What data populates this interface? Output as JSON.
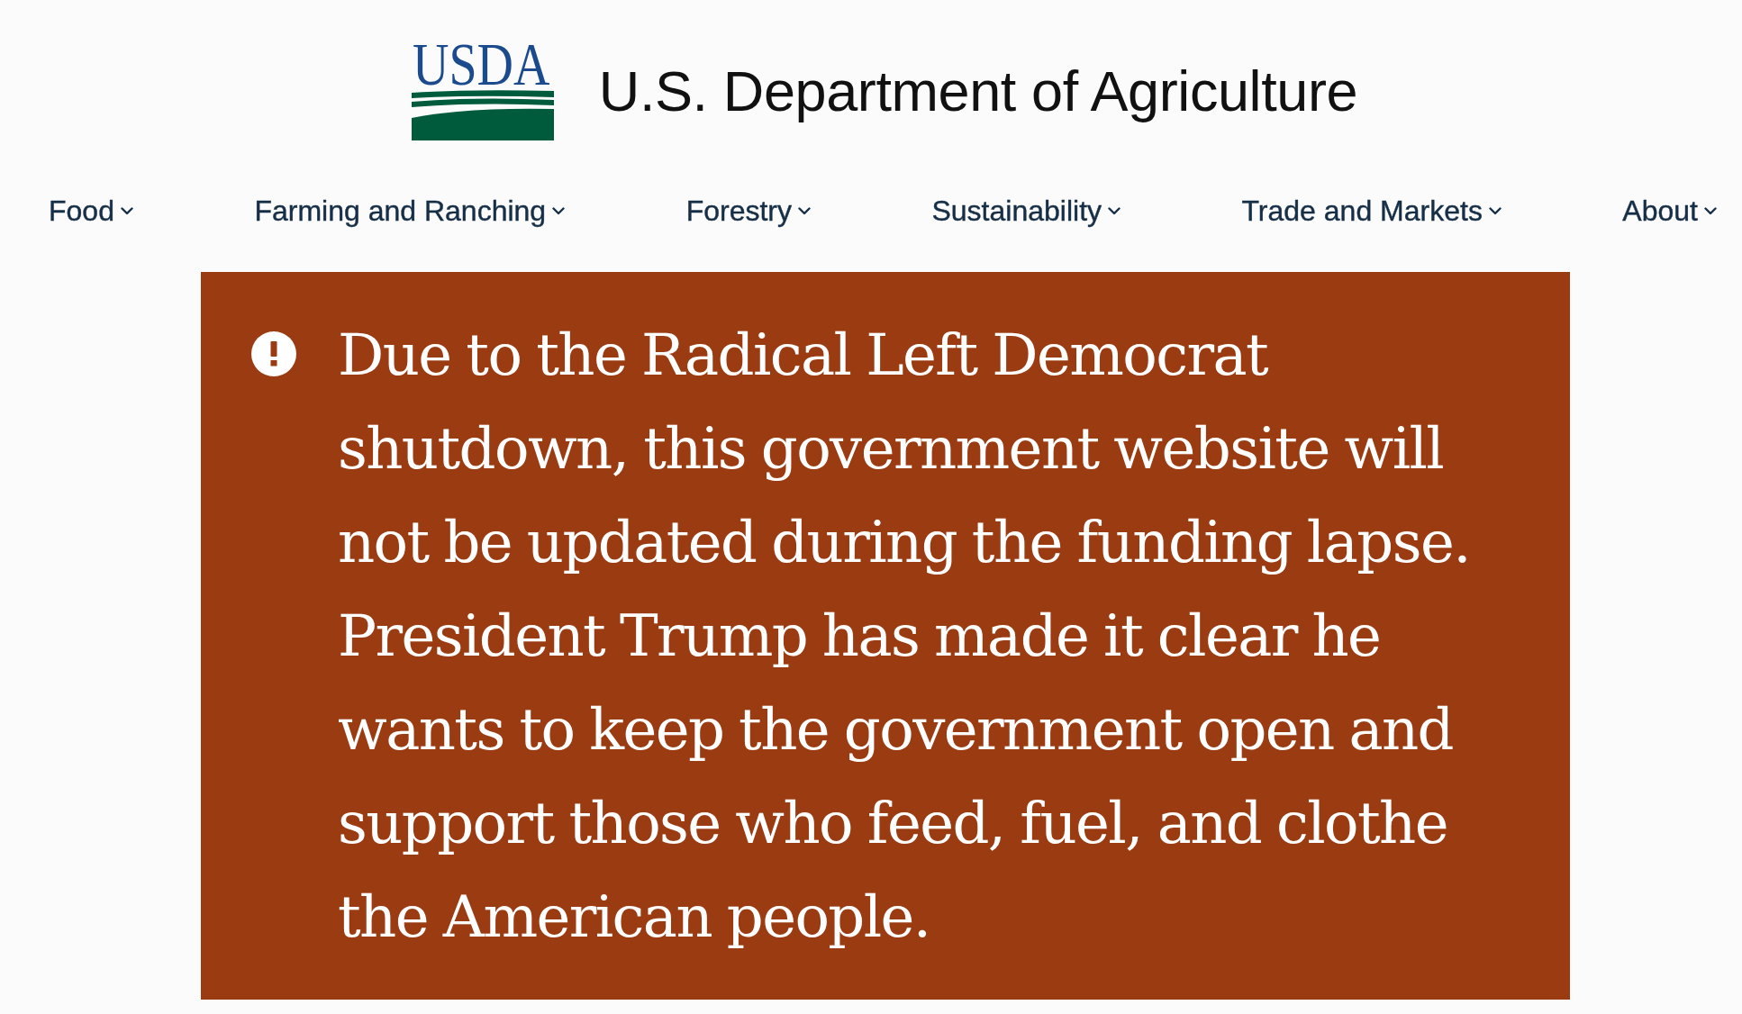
{
  "header": {
    "logo_text": "USDA",
    "title": "U.S. Department of Agriculture"
  },
  "nav": {
    "items": [
      {
        "label": "Food"
      },
      {
        "label": "Farming and Ranching"
      },
      {
        "label": "Forestry"
      },
      {
        "label": "Sustainability"
      },
      {
        "label": "Trade and Markets"
      },
      {
        "label": "About"
      }
    ]
  },
  "alert": {
    "message": "Due to the Radical Left Democrat shutdown, this government website will not be updated during the funding lapse. President Trump has made it clear he wants to keep the government open and support those who feed, fuel, and clothe the American people."
  }
}
